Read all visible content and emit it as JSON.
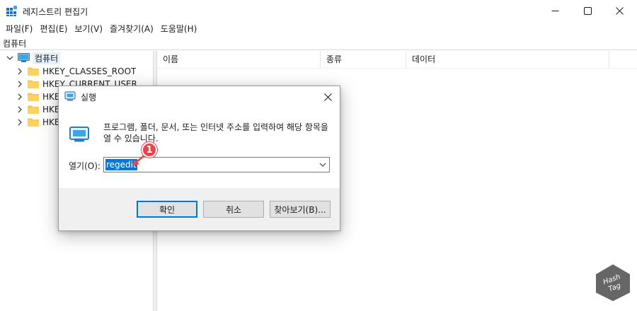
{
  "window": {
    "title": "레지스트리 편집기",
    "minimize_glyph": "—",
    "maximize_glyph": "□",
    "close_glyph": "✕"
  },
  "menu": {
    "items": [
      {
        "label": "파일(F)"
      },
      {
        "label": "편집(E)"
      },
      {
        "label": "보기(V)"
      },
      {
        "label": "즐겨찾기(A)"
      },
      {
        "label": "도움말(H)"
      }
    ]
  },
  "address": {
    "value": "컴퓨터"
  },
  "tree": {
    "root_label": "컴퓨터",
    "keys": [
      {
        "label": "HKEY_CLASSES_ROOT"
      },
      {
        "label": "HKEY_CURRENT_USER"
      },
      {
        "label": "HKE"
      },
      {
        "label": "HKE"
      },
      {
        "label": "HKE"
      }
    ]
  },
  "list": {
    "columns": [
      {
        "label": "이름"
      },
      {
        "label": "종류"
      },
      {
        "label": "데이터"
      }
    ]
  },
  "run_dialog": {
    "title": "실행",
    "description": "프로그램, 폴더, 문서, 또는 인터넷 주소를 입력하여 해당 항목을 열 수 있습니다.",
    "open_label": "열기(O):",
    "input_value": "regedit",
    "ok_label": "확인",
    "cancel_label": "취소",
    "browse_label": "찾아보기(B)..."
  },
  "annotation": {
    "step_number": "1",
    "color": "#e8454b"
  },
  "watermark": {
    "line1": "Hash",
    "line2": "Tag"
  },
  "colors": {
    "selection": "#0078d7",
    "folder": "#f8c74a",
    "dialog_footer": "#f0f0f0"
  },
  "icons": {
    "app": "registry-editor-icon",
    "computer": "computer-icon",
    "folder": "folder-icon",
    "run": "run-icon"
  }
}
